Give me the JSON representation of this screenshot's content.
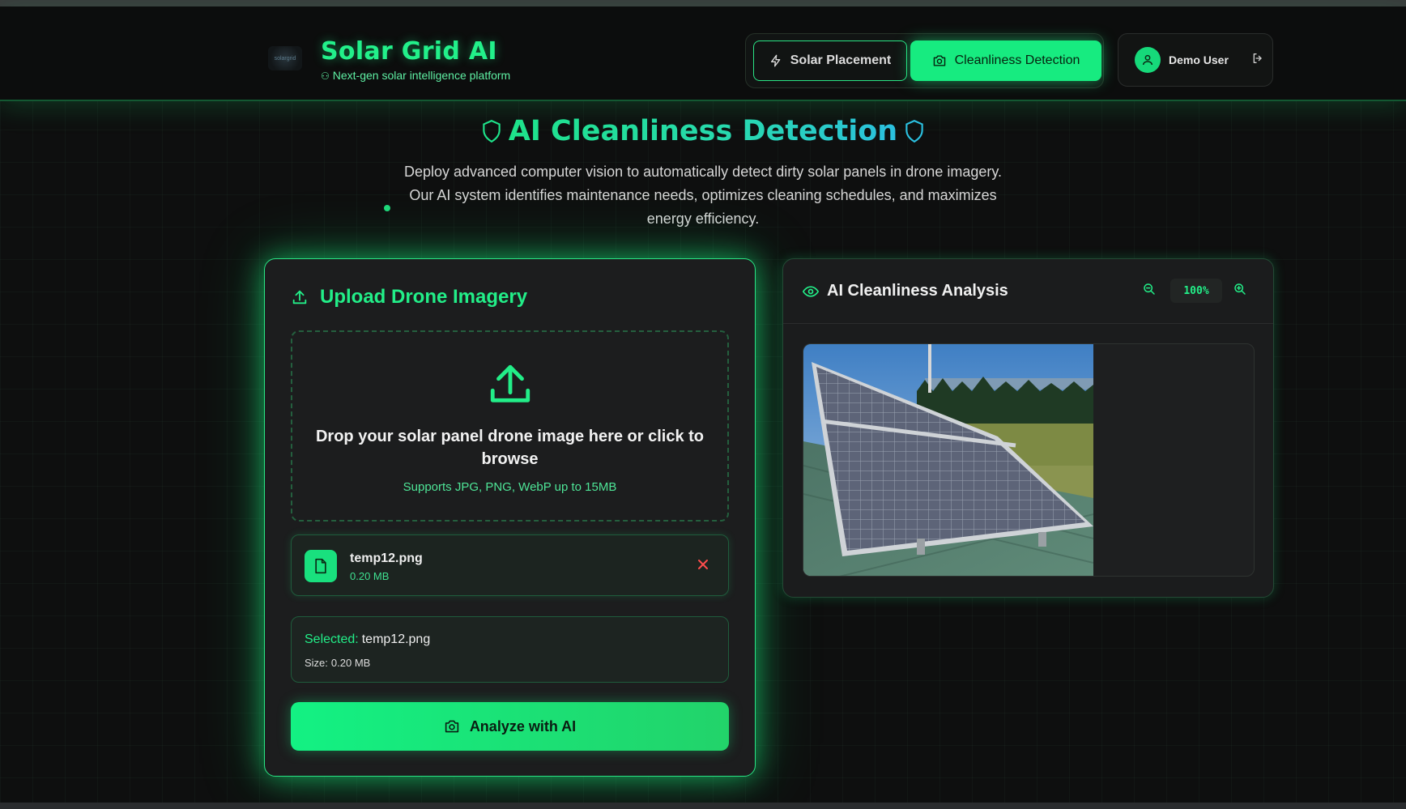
{
  "header": {
    "logo_alt": "solargrid",
    "title": "Solar Grid AI",
    "subtitle": "Next-gen solar intelligence platform",
    "nav": {
      "solar_placement": "Solar Placement",
      "cleanliness_detection": "Cleanliness Detection"
    },
    "user": {
      "name": "Demo User"
    }
  },
  "hero": {
    "title": "AI Cleanliness Detection",
    "description_lines": [
      "Deploy advanced computer vision to automatically detect dirty solar panels in drone imagery.",
      "Our AI system identifies maintenance needs, optimizes cleaning schedules, and maximizes",
      "energy efficiency."
    ]
  },
  "upload": {
    "title": "Upload Drone Imagery",
    "drop_text": "Drop your solar panel drone image here or click to browse",
    "drop_sub": "Supports JPG, PNG, WebP up to 15MB",
    "file": {
      "name": "temp12.png",
      "size": "0.20 MB"
    },
    "selected": {
      "label": "Selected:",
      "name": "temp12.png",
      "size_label": "Size:",
      "size": "0.20 MB"
    },
    "analyze_label": "Analyze with AI"
  },
  "analysis": {
    "title": "AI Cleanliness Analysis",
    "zoom": "100%"
  },
  "colors": {
    "accent": "#22ee88",
    "background": "#0e0f0f",
    "card": "#1c1d1e",
    "danger": "#ff4d4d"
  },
  "icons": {
    "nav_placement": "zap-icon",
    "nav_cleanliness": "camera-icon",
    "user": "user-icon",
    "logout": "logout-icon",
    "hero": "shield-icon",
    "upload": "upload-icon",
    "file": "file-icon",
    "remove": "close-icon",
    "analyze": "camera-icon",
    "analysis": "eye-icon",
    "zoom_out": "zoom-out-icon",
    "zoom_in": "zoom-in-icon"
  }
}
